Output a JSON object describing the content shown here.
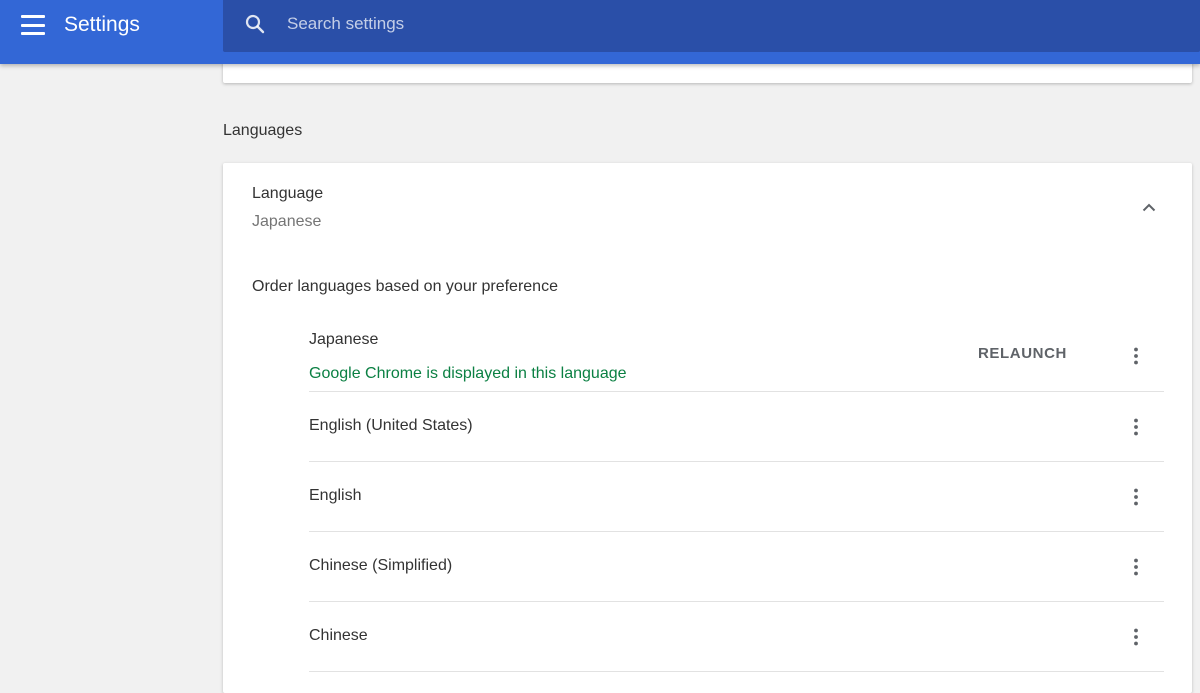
{
  "header": {
    "title": "Settings",
    "search_placeholder": "Search settings"
  },
  "icons": {
    "menu": "hamburger-menu-icon",
    "search": "magnifier-icon",
    "collapse": "chevron-up-icon",
    "more": "vertical-ellipsis-icon"
  },
  "colors": {
    "topbar": "#3367d6",
    "search_bg": "#2a4fa8",
    "active_language_note": "#0b8043"
  },
  "languages_section": {
    "title": "Languages",
    "language_label": "Language",
    "language_value": "Japanese",
    "order_label": "Order languages based on your preference",
    "list": [
      {
        "name": "Japanese",
        "note": "Google Chrome is displayed in this language",
        "action": "RELAUNCH"
      },
      {
        "name": "English (United States)"
      },
      {
        "name": "English"
      },
      {
        "name": "Chinese (Simplified)"
      },
      {
        "name": "Chinese"
      }
    ]
  }
}
